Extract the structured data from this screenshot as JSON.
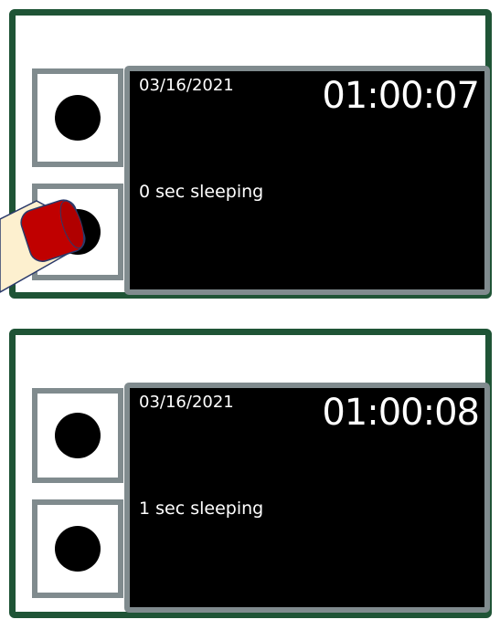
{
  "panels": [
    {
      "date": "03/16/2021",
      "time": "01:00:07",
      "status": "0 sec sleeping",
      "finger_pressing": true
    },
    {
      "date": "03/16/2021",
      "time": "01:00:08",
      "status": "1 sec sleeping",
      "finger_pressing": false
    }
  ],
  "colors": {
    "frame": "#1f5436",
    "bezel": "#808b8e",
    "screen": "#000000",
    "text": "#ffffff",
    "button_dot": "#000000",
    "finger_skin": "#fdf0cf",
    "fingernail": "#c00000"
  }
}
